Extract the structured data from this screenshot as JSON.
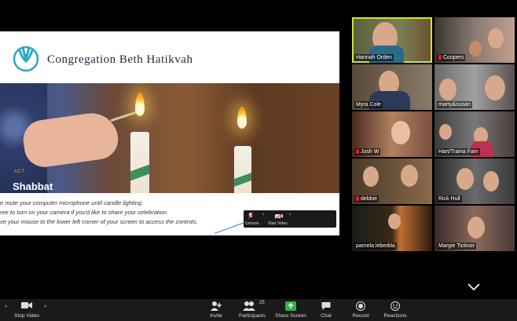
{
  "slide": {
    "congregation_name": "Congregation Beth Hatikvah",
    "activity_label": "ACT",
    "title": "Shabbat",
    "instructions": [
      "e mute your computer microphone until candle lighting.",
      "ree to turn on your camera if you'd like to share your celebration.",
      "ve your mouse to the lower left corner of your screen to access the controls."
    ],
    "mini_toolbar": {
      "unmute": "Unmute",
      "start_video": "Start Video"
    }
  },
  "gallery": [
    {
      "name": "Hannah Orden",
      "muted": false,
      "active": true
    },
    {
      "name": "Coopers",
      "muted": true,
      "active": false
    },
    {
      "name": "Myra Cole",
      "muted": false,
      "active": false
    },
    {
      "name": "marty&susan",
      "muted": false,
      "active": false
    },
    {
      "name": "Josh W",
      "muted": true,
      "active": false
    },
    {
      "name": "Hart/Traina Fam",
      "muted": false,
      "active": false
    },
    {
      "name": "debbie",
      "muted": true,
      "active": false
    },
    {
      "name": "Rick Hull",
      "muted": false,
      "active": false
    },
    {
      "name": "pamela lebedda",
      "muted": false,
      "active": false
    },
    {
      "name": "Margie Ticknor",
      "muted": false,
      "active": false
    }
  ],
  "toolbar": {
    "stop_video": "Stop Video",
    "invite": "Invite",
    "participants": "Participants",
    "participants_count": "25",
    "share_screen": "Share Screen",
    "chat": "Chat",
    "record": "Record",
    "reactions": "Reactions"
  },
  "colors": {
    "active_speaker": "#c9e83b",
    "share_green": "#2fb34a",
    "mute_red": "#e02020"
  }
}
